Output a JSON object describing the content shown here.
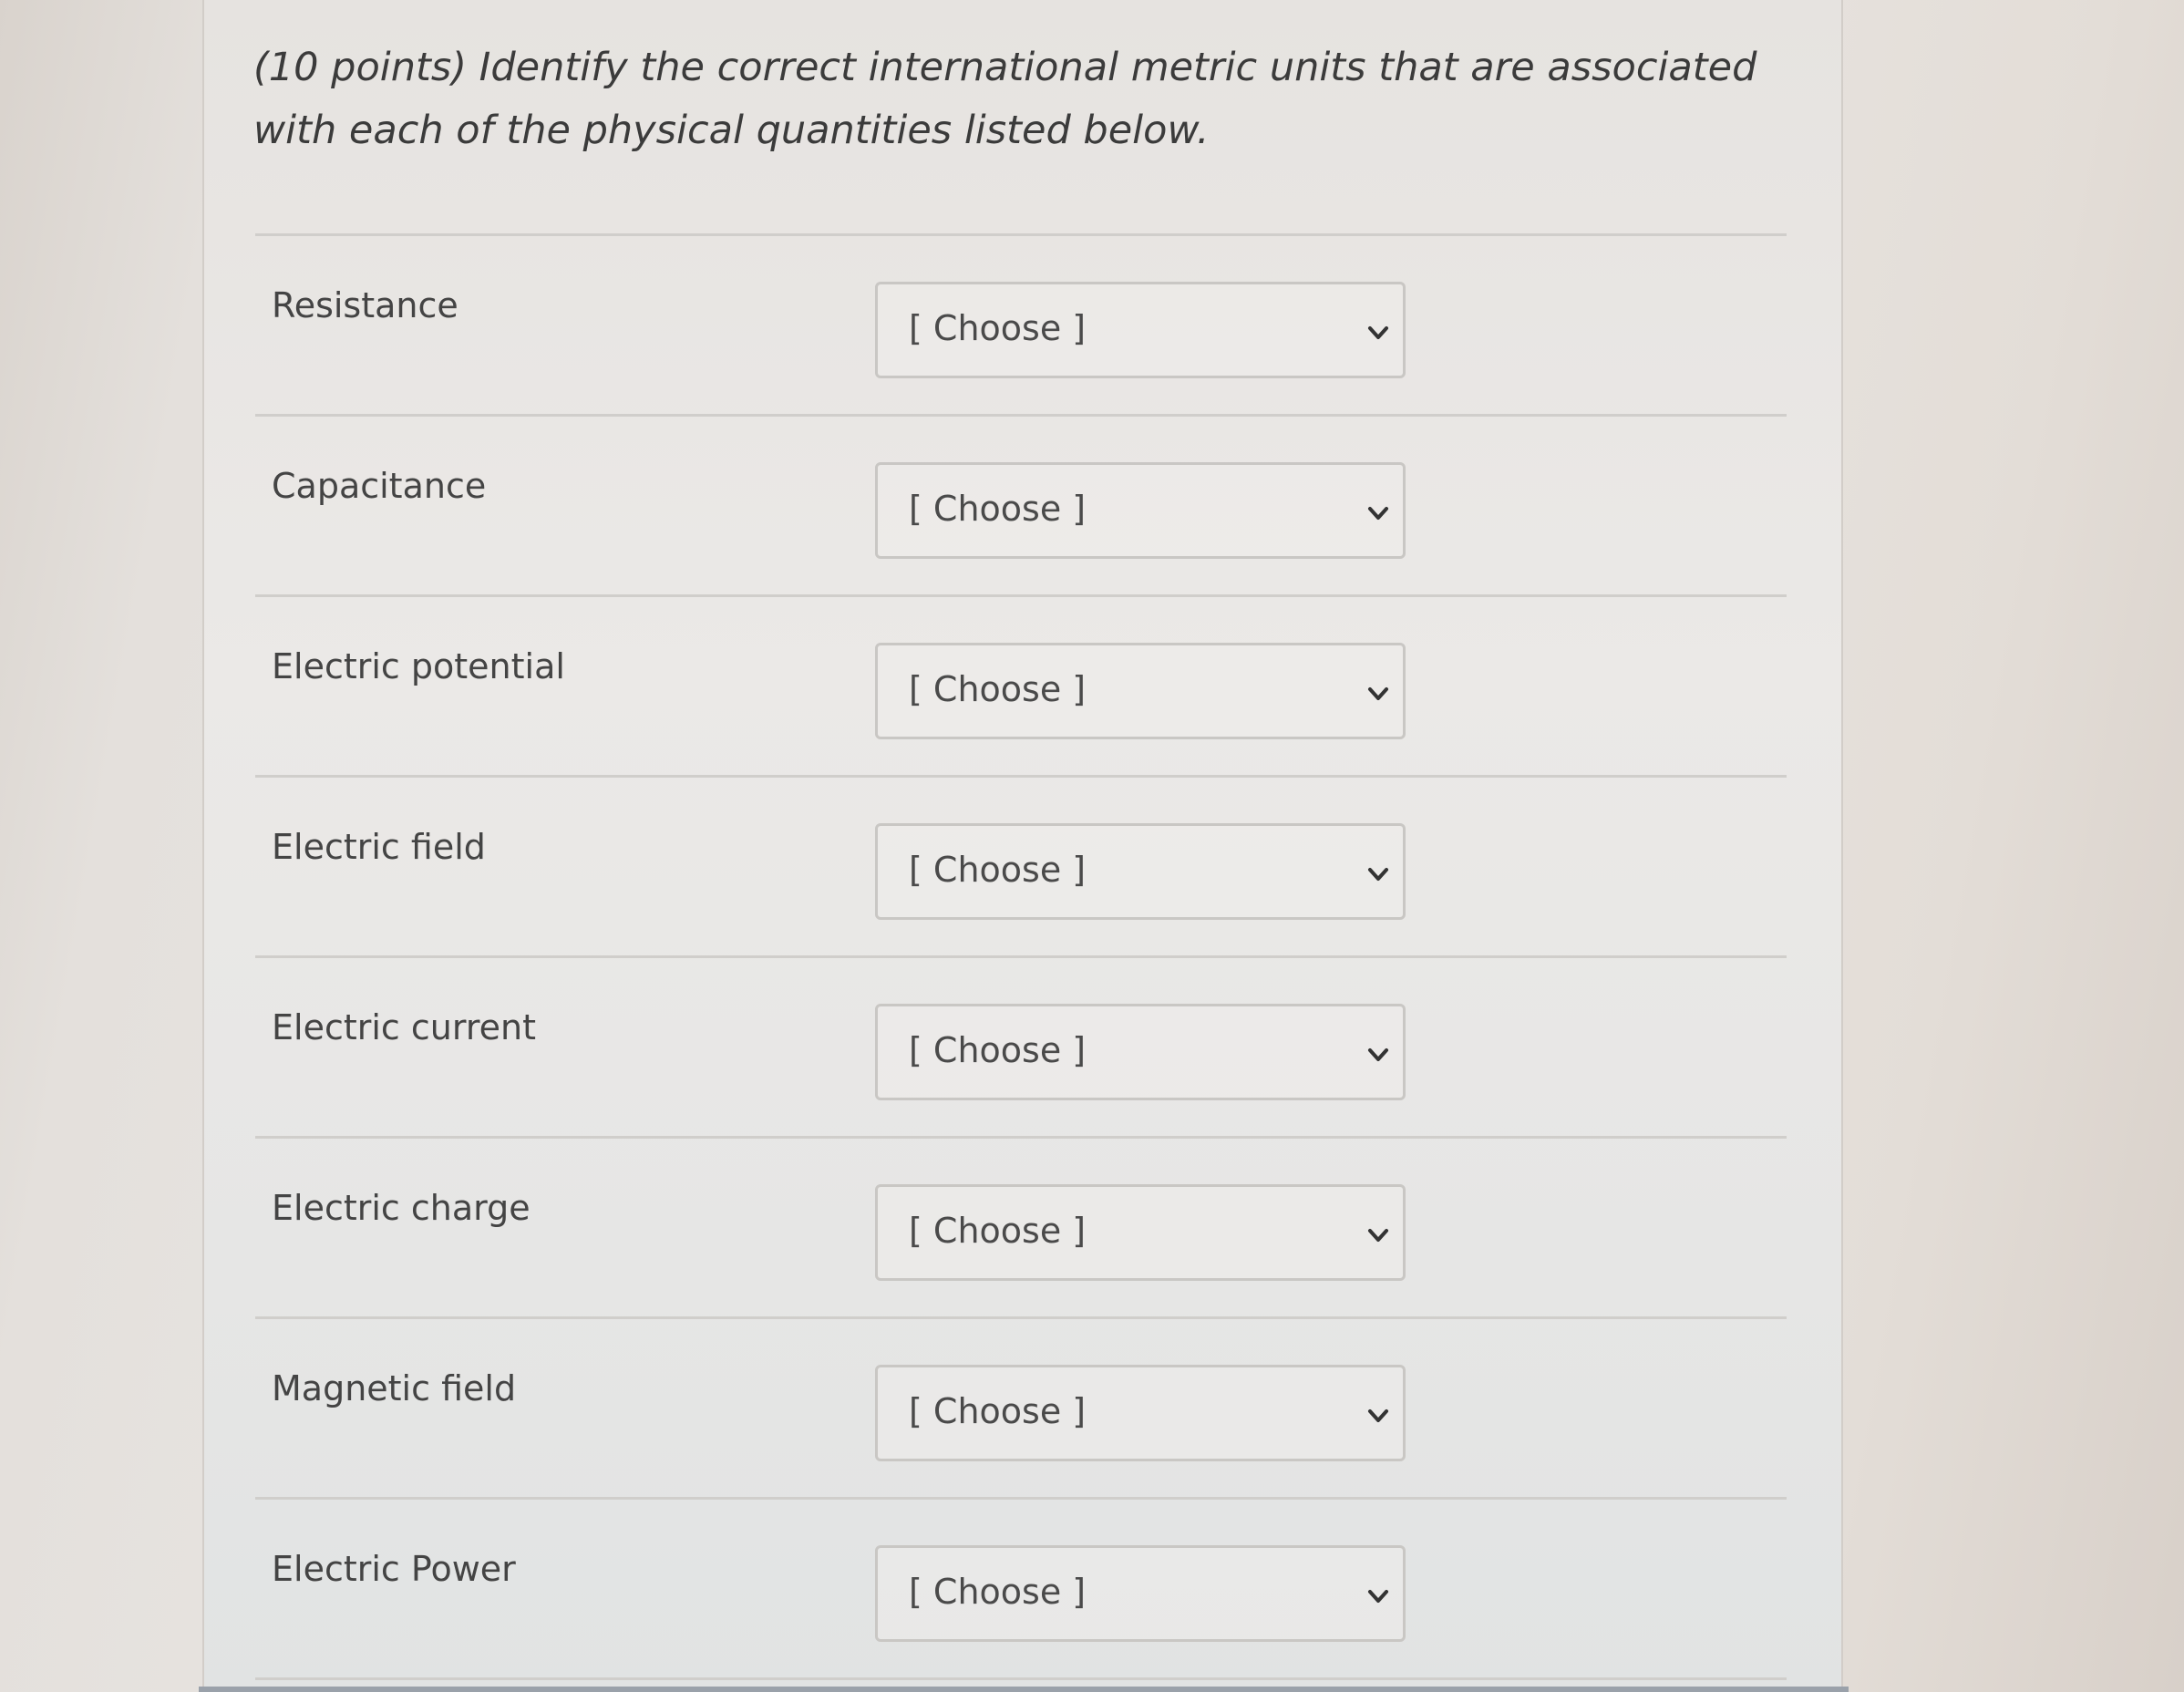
{
  "question": {
    "text": "(10 points) Identify the correct international metric units that are associated with each of the physical quantities listed below."
  },
  "items": [
    {
      "label": "Resistance",
      "selected": "[ Choose ]"
    },
    {
      "label": "Capacitance",
      "selected": "[ Choose ]"
    },
    {
      "label": "Electric potential",
      "selected": "[ Choose ]"
    },
    {
      "label": "Electric field",
      "selected": "[ Choose ]"
    },
    {
      "label": "Electric current",
      "selected": "[ Choose ]"
    },
    {
      "label": "Electric charge",
      "selected": "[ Choose ]"
    },
    {
      "label": "Magnetic field",
      "selected": "[ Choose ]"
    },
    {
      "label": "Electric Power",
      "selected": "[ Choose ]"
    }
  ],
  "icons": {
    "dropdown": "chevron-down-icon"
  },
  "colors": {
    "text": "#444444",
    "border": "#c9c7c4",
    "divider": "#d0cecb"
  }
}
